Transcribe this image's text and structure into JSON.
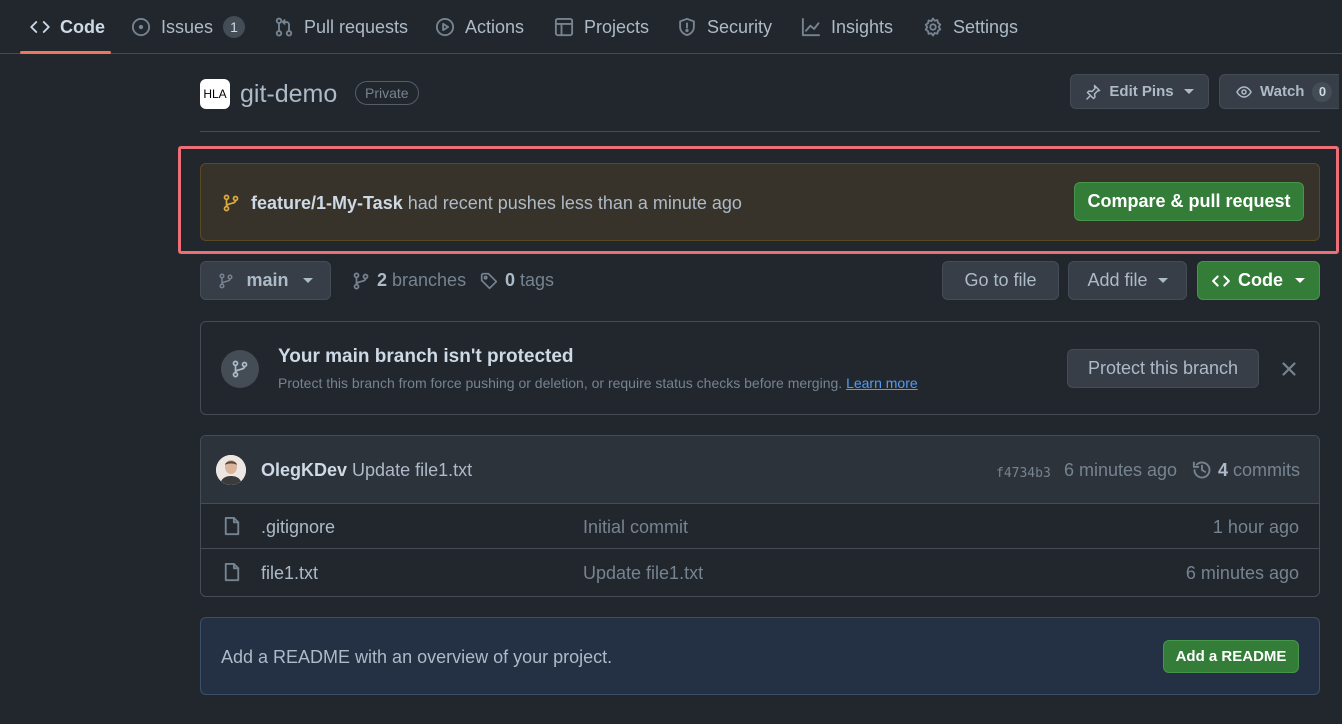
{
  "nav": {
    "tabs": [
      {
        "label": "Code",
        "icon": "code-icon",
        "active": true
      },
      {
        "label": "Issues",
        "icon": "issue-icon",
        "count": "1"
      },
      {
        "label": "Pull requests",
        "icon": "pull-request-icon"
      },
      {
        "label": "Actions",
        "icon": "play-icon"
      },
      {
        "label": "Projects",
        "icon": "table-icon"
      },
      {
        "label": "Security",
        "icon": "shield-icon"
      },
      {
        "label": "Insights",
        "icon": "graph-icon"
      },
      {
        "label": "Settings",
        "icon": "gear-icon"
      }
    ]
  },
  "repo": {
    "avatar_text": "HLA",
    "name": "git-demo",
    "visibility": "Private",
    "edit_pins_label": "Edit Pins",
    "watch_label": "Watch",
    "watch_count": "0"
  },
  "push_banner": {
    "branch": "feature/1-My-Task",
    "message": " had recent pushes less than a minute ago",
    "button_label": "Compare & pull request"
  },
  "branch_bar": {
    "current_branch": "main",
    "branches_count": "2",
    "branches_label": " branches",
    "tags_count": "0",
    "tags_label": " tags",
    "go_to_file_label": "Go to file",
    "add_file_label": "Add file",
    "code_label": "Code"
  },
  "protect": {
    "title": "Your main branch isn't protected",
    "description": "Protect this branch from force pushing or deletion, or require status checks before merging. ",
    "learn_more": "Learn more",
    "button_label": "Protect this branch"
  },
  "latest_commit": {
    "author": "OlegKDev",
    "message": " Update file1.txt",
    "sha": "f4734b3",
    "time": "6 minutes ago",
    "commits_count": "4",
    "commits_label": " commits"
  },
  "files": [
    {
      "name": ".gitignore",
      "commit_message": "Initial commit",
      "time": "1 hour ago"
    },
    {
      "name": "file1.txt",
      "commit_message": "Update file1.txt",
      "time": "6 minutes ago"
    }
  ],
  "readme": {
    "prompt": "Add a README with an overview of your project.",
    "button_label": "Add a README"
  },
  "colors": {
    "background": "#22272e",
    "accent_underline": "#ec775c",
    "green_button": "#347d39",
    "highlight_frame": "#ec6f77",
    "link": "#539bf5"
  }
}
